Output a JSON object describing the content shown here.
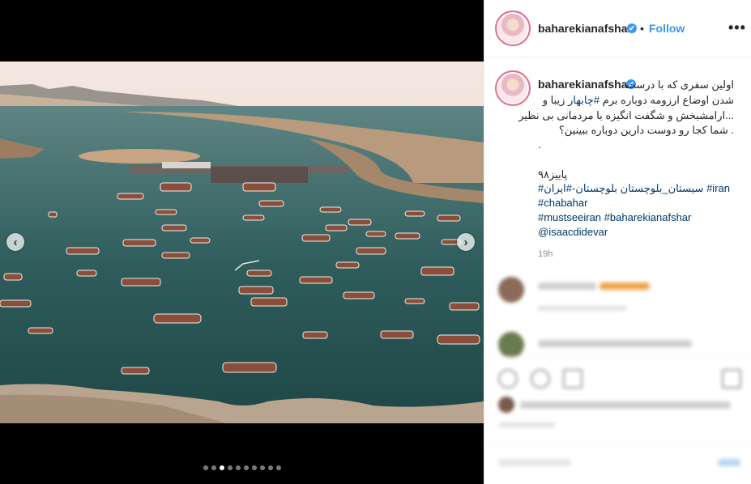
{
  "post": {
    "username": "baharekianafshar",
    "verified_mark": "✔",
    "separator": "•",
    "follow_label": "Follow",
    "more_label": "•••"
  },
  "caption": {
    "author": "baharekianafshar",
    "line1": "اولین سفری که با درست",
    "line2_pre": "شدن اوضاع ارزومه دوباره برم ",
    "line2_tag": "#چابهار",
    "line2_post": " زیبا و",
    "line3": "...ارامشبخش و شگفت انگیزه با مردمانی بی نظیر",
    "line4": ". شما کجا رو دوست دارین دوباره ببینین؟",
    "line5": ".",
    "line6": "پاییز۹۸",
    "tags_line1_a": "#iran",
    "tags_line1_b": "سیستان_بلوچستان بلوچستان-#ایران#",
    "tags_line2": "#chabahar",
    "tags_line3_a": "#mustseeiran",
    "tags_line3_b": "#baharekianafshar",
    "tags_line4": "@isaacdidevar",
    "time": "19h"
  },
  "media": {
    "prev_arrow": "‹",
    "next_arrow": "›",
    "slide_count": 10,
    "active_slide": 3
  }
}
